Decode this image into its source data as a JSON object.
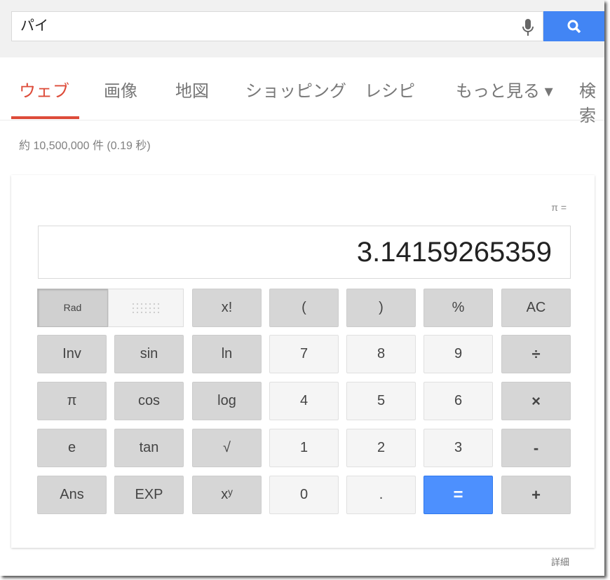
{
  "search": {
    "query": "パイ",
    "mic_icon": "microphone-icon",
    "search_icon": "search-icon",
    "accent": "#4285f4"
  },
  "tabs": [
    {
      "label": "ウェブ",
      "active": true
    },
    {
      "label": "画像"
    },
    {
      "label": "地図"
    },
    {
      "label": "ショッピング"
    },
    {
      "label": "レシピ"
    },
    {
      "label": "もっと見る ▾"
    },
    {
      "label": "検索"
    }
  ],
  "stats": "約 10,500,000 件 (0.19 秒)",
  "calculator": {
    "expression": "π =",
    "result": "3.14159265359",
    "mode": {
      "rad": "Rad",
      "selected": "Rad"
    },
    "rows": [
      [
        {
          "l": "x!",
          "t": "func"
        },
        {
          "l": "(",
          "t": "func"
        },
        {
          "l": ")",
          "t": "func"
        },
        {
          "l": "%",
          "t": "func"
        },
        {
          "l": "AC",
          "t": "func"
        }
      ],
      [
        {
          "l": "Inv",
          "t": "func"
        },
        {
          "l": "sin",
          "t": "func"
        },
        {
          "l": "ln",
          "t": "func"
        },
        {
          "l": "7",
          "t": "num"
        },
        {
          "l": "8",
          "t": "num"
        },
        {
          "l": "9",
          "t": "num"
        },
        {
          "l": "÷",
          "t": "op"
        }
      ],
      [
        {
          "l": "π",
          "t": "func"
        },
        {
          "l": "cos",
          "t": "func"
        },
        {
          "l": "log",
          "t": "func"
        },
        {
          "l": "4",
          "t": "num"
        },
        {
          "l": "5",
          "t": "num"
        },
        {
          "l": "6",
          "t": "num"
        },
        {
          "l": "×",
          "t": "op"
        }
      ],
      [
        {
          "l": "e",
          "t": "func"
        },
        {
          "l": "tan",
          "t": "func"
        },
        {
          "l": "√",
          "t": "func"
        },
        {
          "l": "1",
          "t": "num"
        },
        {
          "l": "2",
          "t": "num"
        },
        {
          "l": "3",
          "t": "num"
        },
        {
          "l": "-",
          "t": "op"
        }
      ],
      [
        {
          "l": "Ans",
          "t": "func"
        },
        {
          "l": "EXP",
          "t": "func"
        },
        {
          "l": "xʸ",
          "t": "func"
        },
        {
          "l": "0",
          "t": "num"
        },
        {
          "l": ".",
          "t": "num"
        },
        {
          "l": "=",
          "t": "eq"
        },
        {
          "l": "+",
          "t": "op"
        }
      ]
    ],
    "equals_color": "#4d90fe"
  },
  "more_link": "詳細"
}
